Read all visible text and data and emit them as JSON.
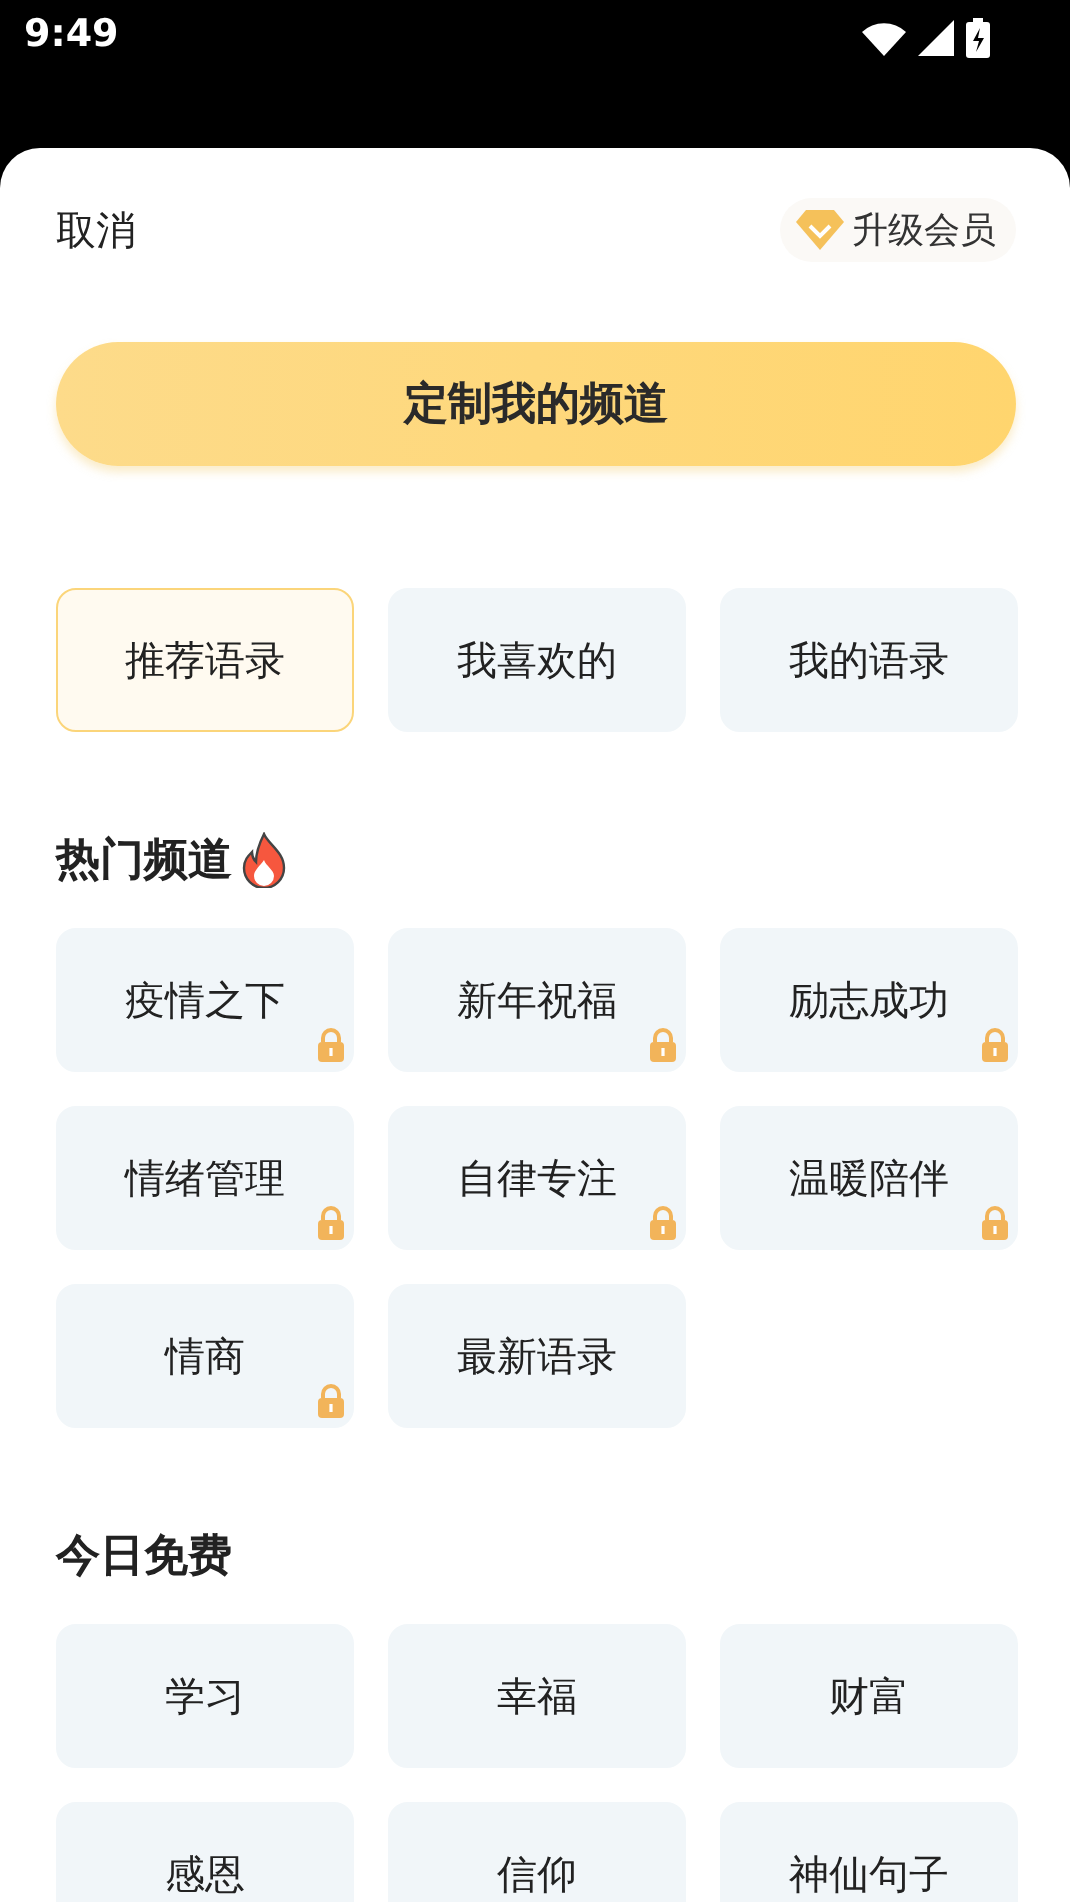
{
  "status_bar": {
    "time": "9:49"
  },
  "header": {
    "cancel": "取消",
    "upgrade": "升级会员"
  },
  "primary_button": "定制我的频道",
  "tabs": [
    {
      "label": "推荐语录",
      "selected": true
    },
    {
      "label": "我喜欢的",
      "selected": false
    },
    {
      "label": "我的语录",
      "selected": false
    }
  ],
  "sections": [
    {
      "title": "热门频道",
      "hot": true,
      "channels": [
        {
          "label": "疫情之下",
          "locked": true
        },
        {
          "label": "新年祝福",
          "locked": true
        },
        {
          "label": "励志成功",
          "locked": true
        },
        {
          "label": "情绪管理",
          "locked": true
        },
        {
          "label": "自律专注",
          "locked": true
        },
        {
          "label": "温暖陪伴",
          "locked": true
        },
        {
          "label": "情商",
          "locked": true
        },
        {
          "label": "最新语录",
          "locked": false
        }
      ]
    },
    {
      "title": "今日免费",
      "hot": false,
      "channels": [
        {
          "label": "学习",
          "locked": false
        },
        {
          "label": "幸福",
          "locked": false
        },
        {
          "label": "财富",
          "locked": false
        },
        {
          "label": "感恩",
          "locked": false
        },
        {
          "label": "信仰",
          "locked": false
        },
        {
          "label": "神仙句子",
          "locked": false
        }
      ]
    }
  ]
}
